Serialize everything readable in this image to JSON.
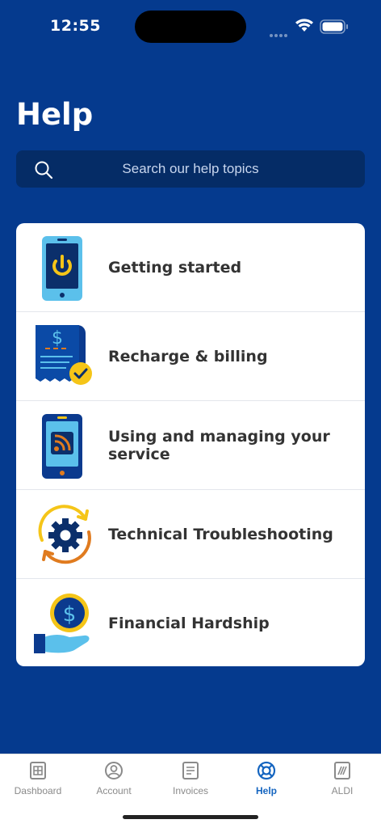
{
  "status_bar": {
    "time": "12:55"
  },
  "page": {
    "title": "Help"
  },
  "search": {
    "placeholder": "Search our help topics"
  },
  "topics": [
    {
      "label": "Getting started",
      "icon": "power-phone-icon"
    },
    {
      "label": "Recharge & billing",
      "icon": "receipt-icon"
    },
    {
      "label": "Using and managing your service",
      "icon": "signal-phone-icon"
    },
    {
      "label": "Technical Troubleshooting",
      "icon": "gear-cycle-icon"
    },
    {
      "label": "Financial Hardship",
      "icon": "hand-coin-icon"
    }
  ],
  "tabbar": {
    "items": [
      {
        "label": "Dashboard",
        "icon": "dashboard-icon",
        "active": false
      },
      {
        "label": "Account",
        "icon": "account-icon",
        "active": false
      },
      {
        "label": "Invoices",
        "icon": "invoices-icon",
        "active": false
      },
      {
        "label": "Help",
        "icon": "help-icon",
        "active": true
      },
      {
        "label": "ALDI",
        "icon": "aldi-icon",
        "active": false
      }
    ]
  },
  "colors": {
    "background": "#053a8e",
    "search_bg": "#052c66",
    "active_tab": "#1565c0",
    "accent_yellow": "#f5c518",
    "accent_light_blue": "#5bc0eb",
    "accent_orange": "#e07b1f"
  }
}
